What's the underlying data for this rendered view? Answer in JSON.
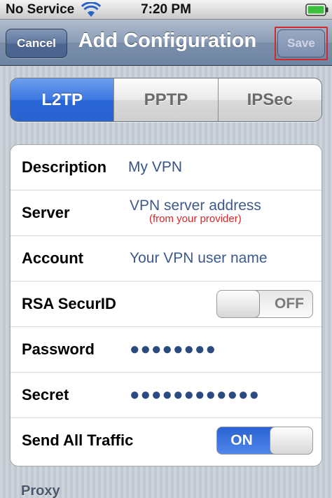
{
  "status_bar": {
    "carrier": "No Service",
    "time": "7:20 PM",
    "wifi_icon": "wifi-icon",
    "battery_icon": "battery-icon"
  },
  "nav_bar": {
    "cancel_label": "Cancel",
    "title": "Add Configuration",
    "save_label": "Save",
    "save_enabled": false,
    "save_highlight_color": "#d22a2a"
  },
  "segments": {
    "items": [
      "L2TP",
      "PPTP",
      "IPSec"
    ],
    "selected": "L2TP",
    "selected_color": "#3c78e0"
  },
  "form": {
    "description": {
      "label": "Description",
      "value": "My VPN"
    },
    "server": {
      "label": "Server",
      "placeholder": "VPN server address",
      "hint": "(from your provider)"
    },
    "account": {
      "label": "Account",
      "placeholder": "Your VPN user name"
    },
    "rsa": {
      "label": "RSA SecurID",
      "state": "OFF",
      "on": false
    },
    "password": {
      "label": "Password",
      "masked": "●●●●●●●●"
    },
    "secret": {
      "label": "Secret",
      "masked": "●●●●●●●●●●●●"
    },
    "send_all": {
      "label": "Send All Traffic",
      "state": "ON",
      "on": true
    }
  },
  "proxy_section": {
    "title": "Proxy"
  },
  "colors": {
    "background": "#c5ccd4",
    "value_text": "#385487",
    "hint_text": "#e02424",
    "toggle_on": "#2a62d3"
  }
}
